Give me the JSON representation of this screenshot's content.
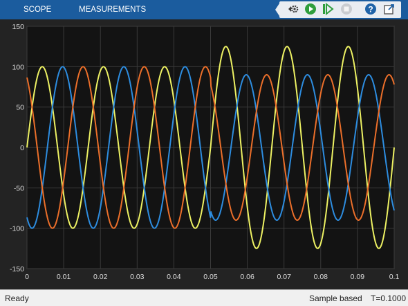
{
  "toolstrip": {
    "tabs": [
      {
        "label": "SCOPE"
      },
      {
        "label": "MEASUREMENTS"
      }
    ],
    "buttons": [
      {
        "icon": "settings-gear-icon",
        "label": ""
      },
      {
        "icon": "run-icon",
        "label": ""
      },
      {
        "icon": "step-forward-icon",
        "label": ""
      },
      {
        "icon": "stop-icon",
        "label": ""
      },
      {
        "icon": "help-icon",
        "label": ""
      },
      {
        "icon": "undock-icon",
        "label": ""
      }
    ]
  },
  "status": {
    "ready": "Ready",
    "mode": "Sample based",
    "time": "T=0.1000"
  },
  "chart_data": {
    "type": "line",
    "title": "",
    "xlabel": "",
    "ylabel": "",
    "xlim": [
      0,
      0.1
    ],
    "ylim": [
      -150,
      150
    ],
    "grid": true,
    "background": "#131313",
    "xticks": [
      0,
      0.01,
      0.02,
      0.03,
      0.04,
      0.05,
      0.06,
      0.07,
      0.08,
      0.09,
      0.1
    ],
    "xtick_labels": [
      "0",
      "0.01",
      "0.02",
      "0.03",
      "0.04",
      "0.05",
      "0.06",
      "0.07",
      "0.08",
      "0.09",
      "0.1"
    ],
    "yticks": [
      -150,
      -100,
      -50,
      0,
      50,
      100,
      150
    ],
    "ytick_labels": [
      "-150",
      "-100",
      "-50",
      "0",
      "50",
      "100",
      "150"
    ],
    "series": [
      {
        "color": "#edf163",
        "segments": [
          {
            "t_start": 0,
            "t_end": 0.05,
            "amplitude": 100,
            "frequency_hz": 60,
            "phase_deg": 0
          },
          {
            "t_start": 0.05,
            "t_end": 0.1,
            "amplitude": 125,
            "frequency_hz": 60,
            "phase_deg": 0
          }
        ]
      },
      {
        "color": "#2d8de0",
        "segments": [
          {
            "t_start": 0,
            "t_end": 0.05,
            "amplitude": 100,
            "frequency_hz": 60,
            "phase_deg": -120
          },
          {
            "t_start": 0.05,
            "t_end": 0.1,
            "amplitude": 90,
            "frequency_hz": 60,
            "phase_deg": -120
          }
        ]
      },
      {
        "color": "#ec6f2a",
        "segments": [
          {
            "t_start": 0,
            "t_end": 0.05,
            "amplitude": 100,
            "frequency_hz": 60,
            "phase_deg": 120
          },
          {
            "t_start": 0.05,
            "t_end": 0.1,
            "amplitude": 90,
            "frequency_hz": 60,
            "phase_deg": 120
          }
        ]
      }
    ]
  }
}
